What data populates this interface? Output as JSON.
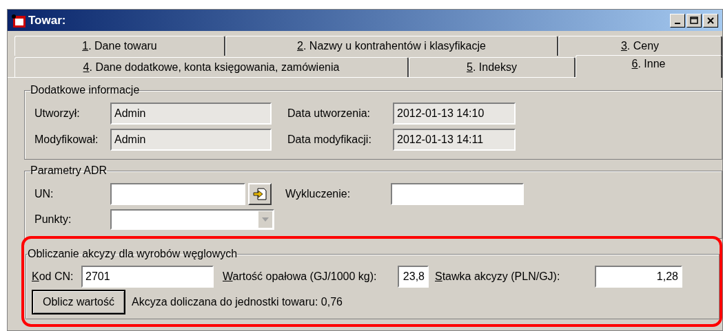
{
  "window": {
    "title": "Towar:"
  },
  "tab_rows": [
    [
      {
        "label": "1. Dane towaru",
        "selected": false
      },
      {
        "label": "2. Nazwy u kontrahentów i klasyfikacje",
        "selected": false
      },
      {
        "label": "3. Ceny",
        "selected": false
      }
    ],
    [
      {
        "label": "4. Dane dodatkowe, konta księgowania, zamówienia",
        "selected": false
      },
      {
        "label": "5. Indeksy",
        "selected": false
      },
      {
        "label": "6. Inne",
        "selected": true
      }
    ]
  ],
  "info": {
    "title": "Dodatkowe informacje",
    "created_by_label": "Utworzył:",
    "created_by": "Admin",
    "created_at_label": "Data utworzenia:",
    "created_at": "2012-01-13 14:10",
    "modified_by_label": "Modyfikował:",
    "modified_by": "Admin",
    "modified_at_label": "Data modyfikacji:",
    "modified_at": "2012-01-13 14:11"
  },
  "adr": {
    "title": "Parametry ADR",
    "un_label": "UN:",
    "exclusion_label": "Wykluczenie:",
    "points_label": "Punkty:"
  },
  "excise": {
    "title": "Obliczanie akcyzy dla wyrobów węglowych",
    "highlight": true,
    "cn_label": "Kod CN:",
    "cn": "2701",
    "calorific_label": "Wartość opałowa (GJ/1000 kg):",
    "calorific": "23,8",
    "rate_label": "Stawka akcyzy (PLN/GJ):",
    "rate": "1,28",
    "button": "Oblicz wartość",
    "result": "Akcyza doliczana do jednostki towaru: 0,76"
  }
}
